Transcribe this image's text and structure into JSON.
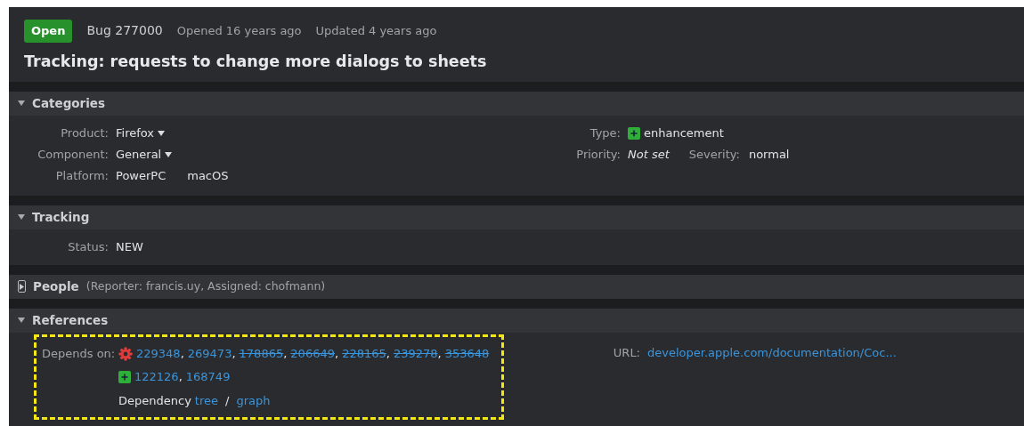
{
  "header": {
    "status_badge": "Open",
    "bug_id": "Bug 277000",
    "opened": "Opened 16 years ago",
    "updated": "Updated 4 years ago",
    "title": "Tracking: requests to change more dialogs to sheets"
  },
  "sections": [
    {
      "title": "Categories",
      "expanded": true,
      "kind": "categories",
      "left": [
        {
          "label": "Product:",
          "values": [
            {
              "text": "Firefox",
              "dropdown": true
            }
          ]
        },
        {
          "label": "Component:",
          "values": [
            {
              "text": "General",
              "dropdown": true
            }
          ]
        },
        {
          "label": "Platform:",
          "values": [
            {
              "text": "PowerPC",
              "dropdown": false
            },
            {
              "text": "macOS",
              "dropdown": false
            }
          ]
        }
      ],
      "type": {
        "label": "Type:",
        "value": "enhancement"
      },
      "priority": {
        "label": "Priority:",
        "value": "Not set"
      },
      "severity": {
        "label": "Severity:",
        "value": "normal"
      }
    },
    {
      "title": "Tracking",
      "expanded": true,
      "kind": "tracking",
      "status": {
        "label": "Status:",
        "value": "NEW"
      }
    },
    {
      "title": "People",
      "expanded": false,
      "kind": "people",
      "summary": "(Reporter: francis.uy, Assigned: chofmann)"
    },
    {
      "title": "References",
      "expanded": true,
      "kind": "references",
      "depends": {
        "label": "Depends on:",
        "highlighted": true,
        "list_separator": ",",
        "groups": [
          {
            "kind": "defect",
            "bugs": [
              {
                "id": "229348",
                "resolved": false
              },
              {
                "id": "269473",
                "resolved": false
              },
              {
                "id": "178865",
                "resolved": true
              },
              {
                "id": "206649",
                "resolved": true
              },
              {
                "id": "228165",
                "resolved": true
              },
              {
                "id": "239278",
                "resolved": true
              },
              {
                "id": "353648",
                "resolved": true
              }
            ]
          },
          {
            "kind": "enhancement",
            "bugs": [
              {
                "id": "122126",
                "resolved": false
              },
              {
                "id": "168749",
                "resolved": false
              }
            ]
          }
        ],
        "dependency_label": "Dependency",
        "tree_link": "tree",
        "separator": "/",
        "graph_link": "graph"
      },
      "url": {
        "label": "URL:",
        "value": "developer.apple.com/documentation/Coc..."
      }
    }
  ]
}
